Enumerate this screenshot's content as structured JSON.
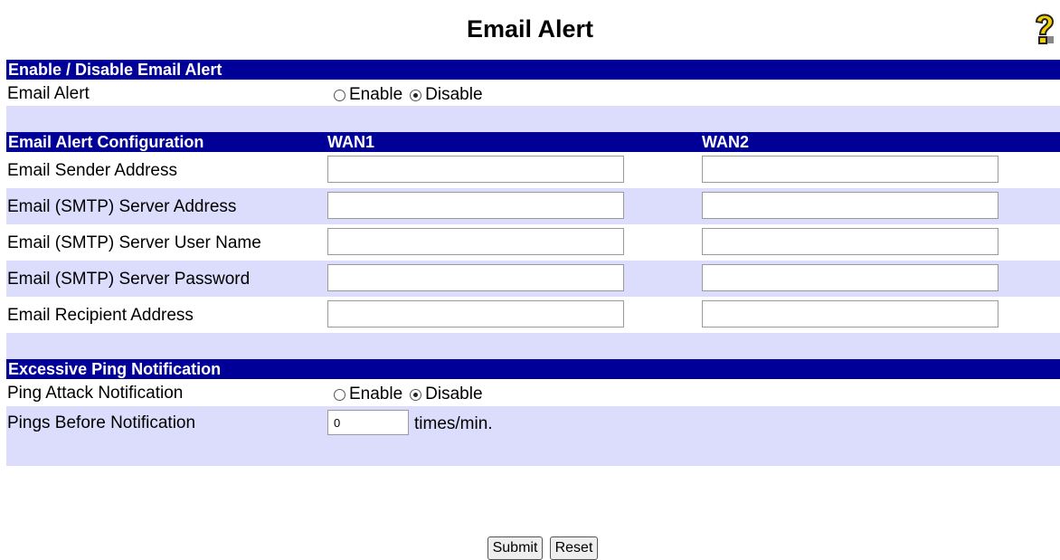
{
  "page": {
    "title": "Email Alert"
  },
  "enable_section": {
    "header": "Enable / Disable Email Alert",
    "email_alert_label": "Email Alert",
    "options": [
      "Enable",
      "Disable"
    ],
    "selected": "Disable"
  },
  "config_section": {
    "header": "Email Alert Configuration",
    "col_wan1": "WAN1",
    "col_wan2": "WAN2",
    "rows": [
      {
        "label": "Email Sender Address",
        "wan1": "",
        "wan2": ""
      },
      {
        "label": "Email (SMTP) Server Address",
        "wan1": "",
        "wan2": ""
      },
      {
        "label": "Email (SMTP) Server User Name",
        "wan1": "",
        "wan2": ""
      },
      {
        "label": "Email (SMTP) Server Password",
        "wan1": "",
        "wan2": ""
      },
      {
        "label": "Email Recipient Address",
        "wan1": "",
        "wan2": ""
      }
    ]
  },
  "ping_section": {
    "header": "Excessive Ping Notification",
    "notify_label": "Ping Attack Notification",
    "options": [
      "Enable",
      "Disable"
    ],
    "selected": "Disable",
    "count_label": "Pings Before Notification",
    "count_value": "0",
    "count_unit": "times/min."
  },
  "buttons": {
    "submit": "Submit",
    "reset": "Reset"
  },
  "colors": {
    "header_bg": "#000099",
    "band": "#dcdcfc",
    "help_icon": "#f2d000"
  },
  "icons": {
    "help": "help-icon"
  }
}
